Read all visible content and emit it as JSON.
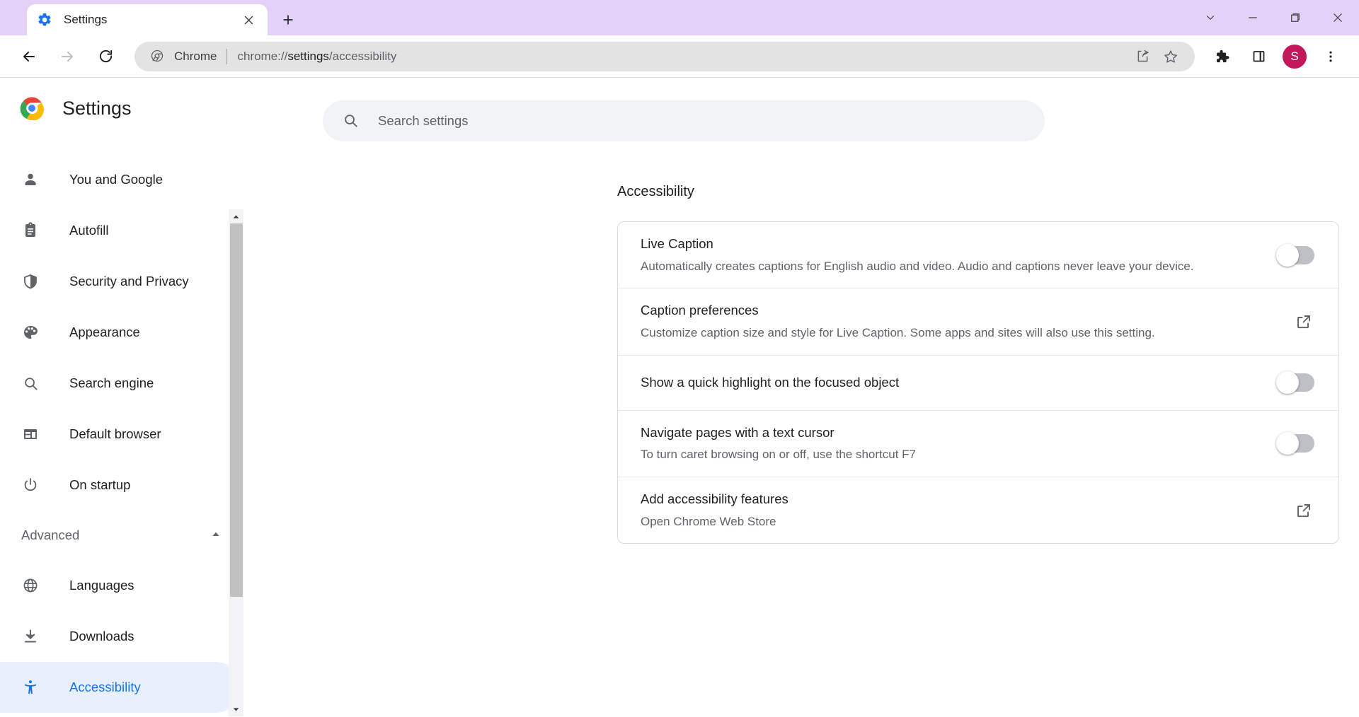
{
  "window": {
    "tab": {
      "title": "Settings",
      "favicon": "settings-gear-icon",
      "close": "close-icon"
    },
    "new_tab": "new-tab-icon",
    "controls": {
      "tab_search": "chevron-down-icon",
      "minimize": "minimize-icon",
      "maximize": "maximize-icon",
      "close": "close-icon"
    },
    "tabstrip_color": "#e4d1f7"
  },
  "toolbar": {
    "back": "back-arrow-icon",
    "forward": "forward-arrow-icon",
    "reload": "reload-icon",
    "omnibox": {
      "site_icon": "chrome-icon",
      "scheme_label": "Chrome",
      "url_prefix": "chrome://",
      "url_bold": "settings",
      "url_suffix": "/accessibility",
      "full_url": "chrome://settings/accessibility",
      "share": "share-icon",
      "bookmark": "star-icon"
    },
    "extensions": "puzzle-piece-icon",
    "side_panel": "side-panel-icon",
    "profile": {
      "initial": "S",
      "color": "#c2185b"
    },
    "menu": "three-dot-menu-icon"
  },
  "sidebar": {
    "brand": {
      "logo": "chrome-logo-icon",
      "title": "Settings"
    },
    "items": [
      {
        "label": "You and Google",
        "icon": "person-icon",
        "selected": false
      },
      {
        "label": "Autofill",
        "icon": "clipboard-icon",
        "selected": false
      },
      {
        "label": "Security and Privacy",
        "icon": "shield-icon",
        "selected": false
      },
      {
        "label": "Appearance",
        "icon": "palette-icon",
        "selected": false
      },
      {
        "label": "Search engine",
        "icon": "search-icon",
        "selected": false
      },
      {
        "label": "Default browser",
        "icon": "browser-window-icon",
        "selected": false
      },
      {
        "label": "On startup",
        "icon": "power-icon",
        "selected": false
      }
    ],
    "advanced": {
      "label": "Advanced",
      "expand_icon": "chevron-up-icon",
      "expanded": true
    },
    "advanced_items": [
      {
        "label": "Languages",
        "icon": "globe-icon",
        "selected": false
      },
      {
        "label": "Downloads",
        "icon": "download-icon",
        "selected": false
      },
      {
        "label": "Accessibility",
        "icon": "accessibility-icon",
        "selected": true
      }
    ],
    "scrollbar": {
      "up": "scroll-up-arrow",
      "down": "scroll-down-arrow",
      "thumb_percent": 78
    },
    "accent_color": "#1a73e8",
    "selected_bg": "#e8f0fe"
  },
  "search": {
    "placeholder": "Search settings",
    "value": "",
    "icon": "search-icon"
  },
  "main": {
    "section_title": "Accessibility",
    "rows": [
      {
        "title": "Live Caption",
        "subtitle": "Automatically creates captions for English audio and video. Audio and captions never leave your device.",
        "control": "toggle",
        "toggle_on": false
      },
      {
        "title": "Caption preferences",
        "subtitle": "Customize caption size and style for Live Caption. Some apps and sites will also use this setting.",
        "control": "external-link",
        "control_icon": "external-link-icon"
      },
      {
        "title": "Show a quick highlight on the focused object",
        "subtitle": "",
        "control": "toggle",
        "toggle_on": false
      },
      {
        "title": "Navigate pages with a text cursor",
        "subtitle": "To turn caret browsing on or off, use the shortcut F7",
        "control": "toggle",
        "toggle_on": false
      },
      {
        "title": "Add accessibility features",
        "subtitle": "Open Chrome Web Store",
        "control": "external-link",
        "control_icon": "external-link-icon"
      }
    ]
  }
}
